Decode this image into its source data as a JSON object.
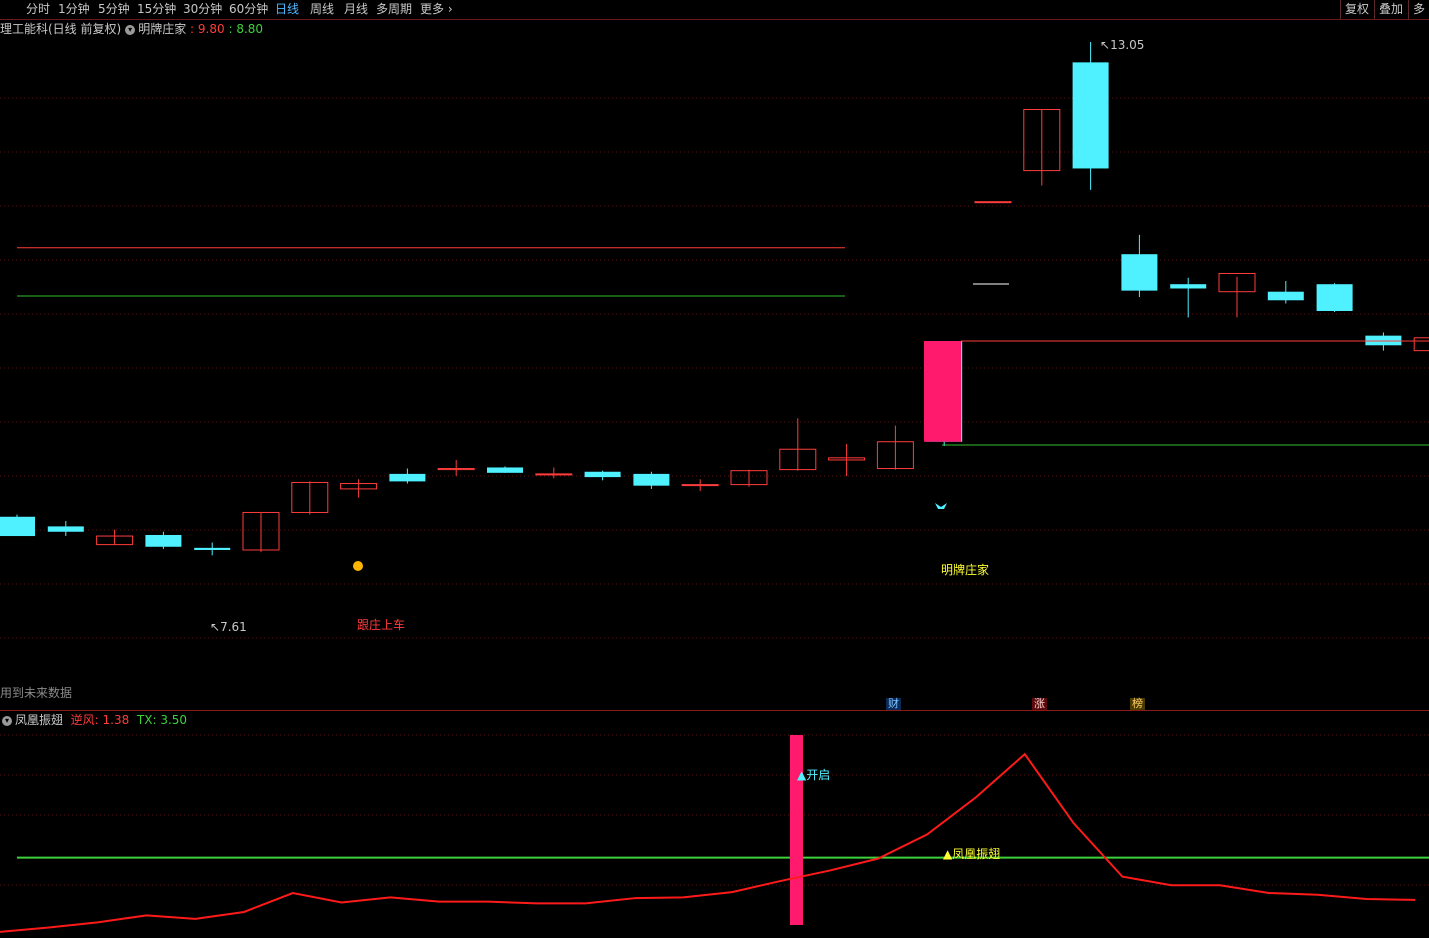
{
  "toolbar": {
    "periods": [
      "分时",
      "1分钟",
      "5分钟",
      "15分钟",
      "30分钟",
      "60分钟",
      "日线",
      "周线",
      "月线",
      "多周期",
      "更多"
    ],
    "active": "日线",
    "right_buttons": [
      "复权",
      "叠加",
      "多"
    ]
  },
  "main_header": {
    "title": "理工能科(日线 前复权)",
    "indicator": "明牌庄家",
    "sep": ":",
    "value1": "9.80",
    "value2": "8.80"
  },
  "main_chart": {
    "high_label": "13.05",
    "low_label": "7.61",
    "label_follow": "跟庄上车",
    "label_banker": "明牌庄家",
    "future_note": "用到未来数据",
    "event_tags": [
      "财",
      "涨",
      "榜"
    ],
    "colors": {
      "up": "#ff3c3c",
      "down": "#4ff0ff",
      "signal": "#ff1a6e",
      "ma": "#ff3c3c",
      "support": "#2fbf2f"
    }
  },
  "sub_header": {
    "name": "凤凰振翅",
    "label1": "逆风",
    "value1": "1.38",
    "label2": "TX",
    "value2": "3.50"
  },
  "sub_chart": {
    "label_open": "▲开启",
    "label_phoenix": "▲凤凰振翅"
  },
  "chart_data": {
    "type": "candlestick",
    "candles": [
      {
        "o": 8.62,
        "h": 8.64,
        "l": 8.44,
        "c": 8.44
      },
      {
        "o": 8.53,
        "h": 8.58,
        "l": 8.44,
        "c": 8.48
      },
      {
        "o": 8.36,
        "h": 8.5,
        "l": 8.36,
        "c": 8.44
      },
      {
        "o": 8.45,
        "h": 8.48,
        "l": 8.32,
        "c": 8.34
      },
      {
        "o": 8.33,
        "h": 8.38,
        "l": 8.26,
        "c": 8.31
      },
      {
        "o": 8.31,
        "h": 8.66,
        "l": 8.29,
        "c": 8.66
      },
      {
        "o": 8.66,
        "h": 8.95,
        "l": 8.64,
        "c": 8.94
      },
      {
        "o": 8.88,
        "h": 8.97,
        "l": 8.8,
        "c": 8.93
      },
      {
        "o": 9.02,
        "h": 9.07,
        "l": 8.93,
        "c": 8.95
      },
      {
        "o": 9.06,
        "h": 9.15,
        "l": 9.0,
        "c": 9.07
      },
      {
        "o": 9.08,
        "h": 9.09,
        "l": 9.03,
        "c": 9.03
      },
      {
        "o": 9.02,
        "h": 9.08,
        "l": 8.98,
        "c": 9.02
      },
      {
        "o": 9.04,
        "h": 9.05,
        "l": 8.96,
        "c": 8.99
      },
      {
        "o": 9.02,
        "h": 9.04,
        "l": 8.88,
        "c": 8.91
      },
      {
        "o": 8.92,
        "h": 8.97,
        "l": 8.86,
        "c": 8.92
      },
      {
        "o": 8.92,
        "h": 9.06,
        "l": 8.9,
        "c": 9.05
      },
      {
        "o": 9.06,
        "h": 9.54,
        "l": 9.05,
        "c": 9.25
      },
      {
        "o": 9.15,
        "h": 9.3,
        "l": 9.0,
        "c": 9.17
      },
      {
        "o": 9.07,
        "h": 9.47,
        "l": 9.06,
        "c": 9.32
      },
      {
        "o": 10.26,
        "h": 10.26,
        "l": 9.28,
        "c": 9.32
      },
      {
        "o": 11.56,
        "h": 11.56,
        "l": 11.56,
        "c": 11.56
      },
      {
        "o": 11.85,
        "h": 12.42,
        "l": 11.71,
        "c": 12.42
      },
      {
        "o": 12.86,
        "h": 13.05,
        "l": 11.67,
        "c": 11.87
      },
      {
        "o": 11.07,
        "h": 11.25,
        "l": 10.67,
        "c": 10.73
      },
      {
        "o": 10.79,
        "h": 10.85,
        "l": 10.48,
        "c": 10.75
      },
      {
        "o": 10.72,
        "h": 10.86,
        "l": 10.48,
        "c": 10.89
      },
      {
        "o": 10.72,
        "h": 10.82,
        "l": 10.61,
        "c": 10.64
      },
      {
        "o": 10.79,
        "h": 10.8,
        "l": 10.53,
        "c": 10.54
      },
      {
        "o": 10.31,
        "h": 10.34,
        "l": 10.17,
        "c": 10.22
      },
      {
        "o": 10.17,
        "h": 10.31,
        "l": 10.17,
        "c": 10.29
      }
    ],
    "ma_line_value": 10.26,
    "support_value": 9.29,
    "reference_red": 11.13,
    "reference_green": 10.68,
    "phoenix_line": [
      0.3,
      0.55,
      0.85,
      1.25,
      1.05,
      1.45,
      2.55,
      2.0,
      2.3,
      2.05,
      2.05,
      1.95,
      1.95,
      2.25,
      2.3,
      2.6,
      3.25,
      3.85,
      4.55,
      5.95,
      8.1,
      10.6,
      6.6,
      3.5,
      3.0,
      3.0,
      2.55,
      2.45,
      2.2,
      2.15
    ],
    "phoenix_threshold": 4.6,
    "phoenix_ylim": [
      0,
      12
    ]
  }
}
